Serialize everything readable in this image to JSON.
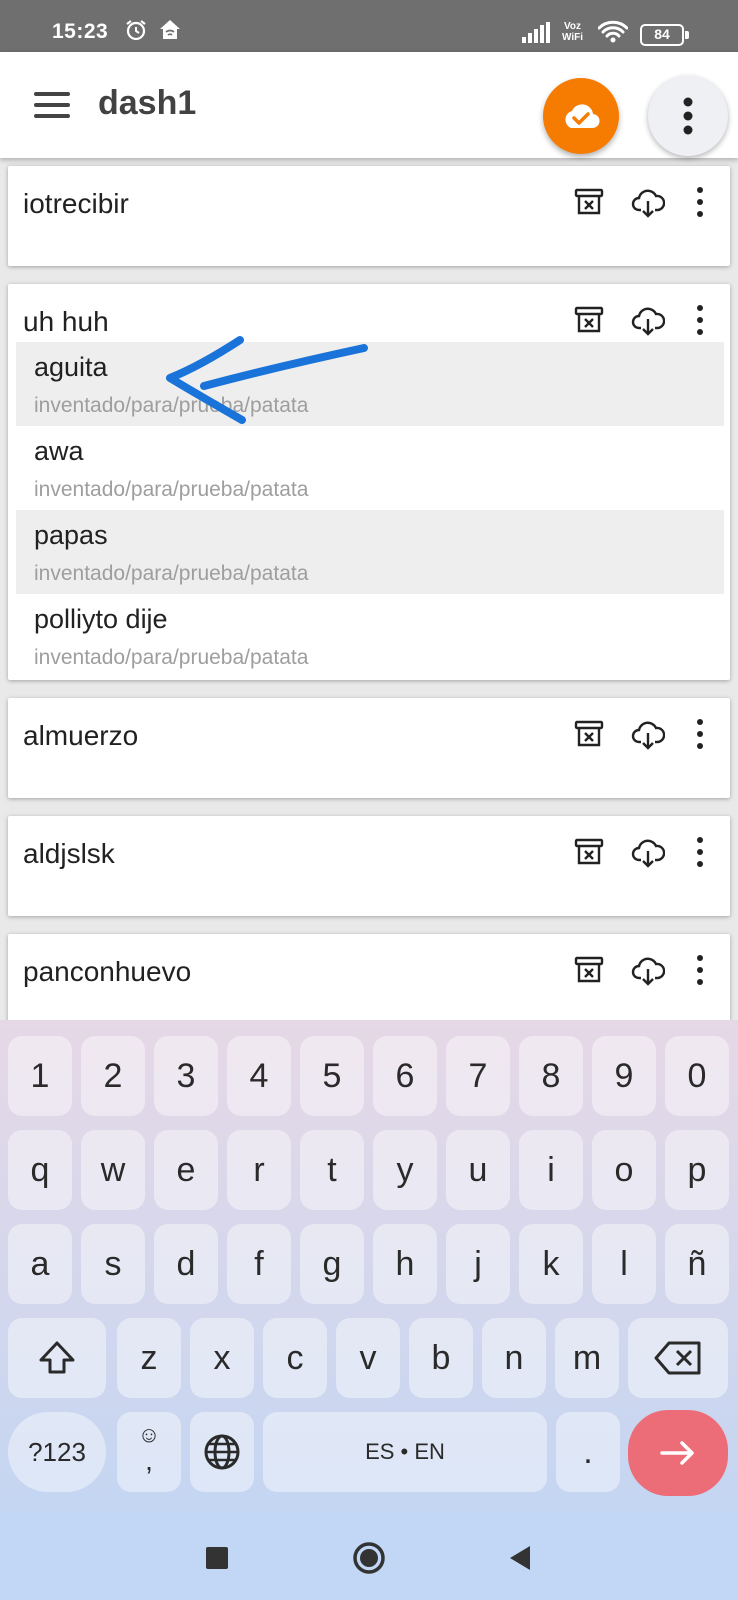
{
  "status_bar": {
    "time": "15:23",
    "voz_line1": "Voz",
    "voz_line2": "WiFi",
    "battery": "84",
    "icons": [
      "alarm-icon",
      "home-wifi-icon",
      "signal-icon",
      "wifi-icon",
      "battery-icon"
    ]
  },
  "app_bar": {
    "title": "dash1",
    "sync_button_color": "#f57c00",
    "icons": [
      "menu-icon",
      "cloud-check-icon",
      "more-vert-icon"
    ]
  },
  "cards": [
    {
      "title": "iotrecibir",
      "items": []
    },
    {
      "title": "uh huh",
      "items": [
        {
          "name": "aguita",
          "path": "inventado/para/prueba/patata"
        },
        {
          "name": "awa",
          "path": "inventado/para/prueba/patata"
        },
        {
          "name": "papas",
          "path": "inventado/para/prueba/patata"
        },
        {
          "name": "polliyto dije",
          "path": "inventado/para/prueba/patata"
        }
      ]
    },
    {
      "title": "almuerzo",
      "items": []
    },
    {
      "title": "aldjslsk",
      "items": []
    },
    {
      "title": "panconhuevo",
      "items": []
    }
  ],
  "card_action_icons": [
    "archive-x-icon",
    "cloud-download-icon",
    "more-vert-icon"
  ],
  "annotation_color": "#1a73d9",
  "keyboard": {
    "row_numbers": [
      "1",
      "2",
      "3",
      "4",
      "5",
      "6",
      "7",
      "8",
      "9",
      "0"
    ],
    "row_top": [
      "q",
      "w",
      "e",
      "r",
      "t",
      "y",
      "u",
      "i",
      "o",
      "p"
    ],
    "row_home": [
      "a",
      "s",
      "d",
      "f",
      "g",
      "h",
      "j",
      "k",
      "l",
      "ñ"
    ],
    "row_bottom": [
      "z",
      "x",
      "c",
      "v",
      "b",
      "n",
      "m"
    ],
    "symbols_label": "?123",
    "emoji_symbol": "☺",
    "comma_label": ",",
    "space_label": "ES • EN",
    "period_label": ".",
    "enter_color": "#ec6d78"
  },
  "nav_bar": {
    "icons": [
      "recents-icon",
      "home-icon",
      "back-icon"
    ]
  }
}
